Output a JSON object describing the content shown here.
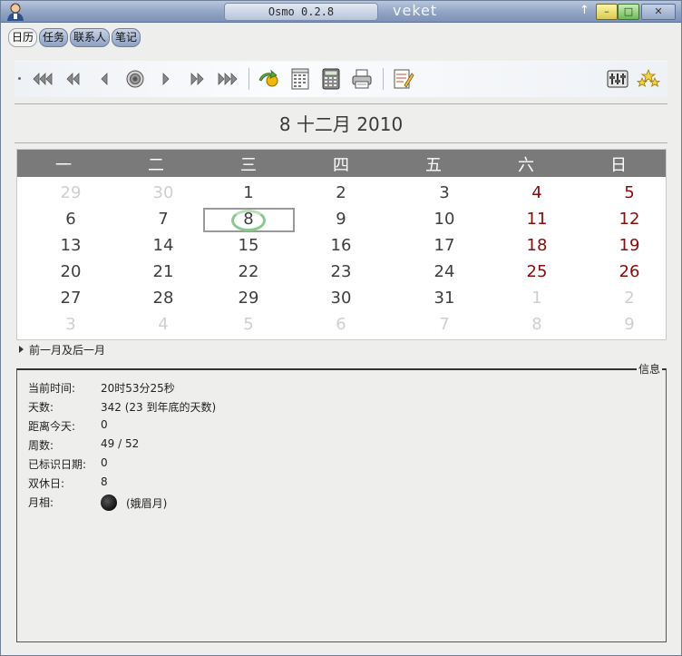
{
  "window": {
    "title": "Osmo 0.2.8",
    "brand": "veket",
    "arrow_glyph": "↑",
    "min_glyph": "–",
    "max_glyph": "□",
    "close_glyph": "✕"
  },
  "tabs": [
    {
      "label": "日历",
      "active": true
    },
    {
      "label": "任务",
      "active": false
    },
    {
      "label": "联系人",
      "active": false
    },
    {
      "label": "笔记",
      "active": false
    }
  ],
  "toolbar": {
    "icons": [
      "prev-year-icon",
      "prev-month-icon",
      "prev-day-icon",
      "today-icon",
      "next-day-icon",
      "next-month-icon",
      "next-year-icon",
      "jump-to-date-icon",
      "full-year-icon",
      "calculator-icon",
      "print-icon",
      "edit-note-icon",
      "preferences-icon",
      "about-icon"
    ]
  },
  "date_title": "8 十二月 2010",
  "calendar": {
    "weekdays": [
      "一",
      "二",
      "三",
      "四",
      "五",
      "六",
      "日"
    ],
    "weeks": [
      [
        {
          "d": "29",
          "o": true
        },
        {
          "d": "30",
          "o": true
        },
        {
          "d": "1"
        },
        {
          "d": "2"
        },
        {
          "d": "3"
        },
        {
          "d": "4",
          "w": true
        },
        {
          "d": "5",
          "w": true
        }
      ],
      [
        {
          "d": "6"
        },
        {
          "d": "7"
        },
        {
          "d": "8",
          "t": true
        },
        {
          "d": "9"
        },
        {
          "d": "10"
        },
        {
          "d": "11",
          "w": true
        },
        {
          "d": "12",
          "w": true
        }
      ],
      [
        {
          "d": "13"
        },
        {
          "d": "14"
        },
        {
          "d": "15"
        },
        {
          "d": "16"
        },
        {
          "d": "17"
        },
        {
          "d": "18",
          "w": true
        },
        {
          "d": "19",
          "w": true
        }
      ],
      [
        {
          "d": "20"
        },
        {
          "d": "21"
        },
        {
          "d": "22"
        },
        {
          "d": "23"
        },
        {
          "d": "24"
        },
        {
          "d": "25",
          "w": true
        },
        {
          "d": "26",
          "w": true
        }
      ],
      [
        {
          "d": "27"
        },
        {
          "d": "28"
        },
        {
          "d": "29"
        },
        {
          "d": "30"
        },
        {
          "d": "31"
        },
        {
          "d": "1",
          "o": true
        },
        {
          "d": "2",
          "o": true
        }
      ],
      [
        {
          "d": "3",
          "o": true
        },
        {
          "d": "4",
          "o": true
        },
        {
          "d": "5",
          "o": true
        },
        {
          "d": "6",
          "o": true
        },
        {
          "d": "7",
          "o": true
        },
        {
          "d": "8",
          "o": true
        },
        {
          "d": "9",
          "o": true
        }
      ]
    ],
    "colors": {
      "header_bg": "#7a7a7a",
      "weekend": "#8b0a0a",
      "other_month": "#cfcfcf",
      "today_ring": "#88c98c"
    }
  },
  "expander_label": "前一月及后一月",
  "info": {
    "legend": "信息",
    "rows": [
      {
        "key": "当前时间:",
        "value": "20时53分25秒"
      },
      {
        "key": "天数:",
        "value": "342 (23 到年底的天数)"
      },
      {
        "key": "距离今天:",
        "value": "0"
      },
      {
        "key": "周数:",
        "value": "49 / 52"
      },
      {
        "key": "已标识日期:",
        "value": "0"
      },
      {
        "key": "双休日:",
        "value": "8"
      },
      {
        "key": "月相:",
        "value": "(娥眉月)"
      }
    ]
  }
}
